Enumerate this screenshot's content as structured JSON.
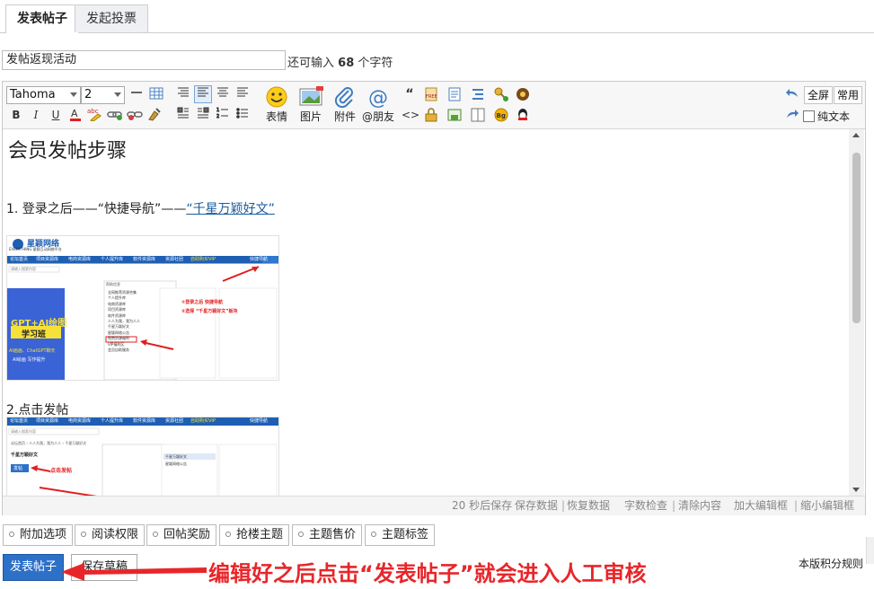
{
  "tabs": [
    {
      "label": "发表帖子",
      "active": true
    },
    {
      "label": "发起投票",
      "active": false
    }
  ],
  "subject": {
    "value": "发帖返现活动",
    "counter_prefix": "还可输入",
    "counter_number": "68",
    "counter_suffix": "个字符"
  },
  "toolbar": {
    "font_family": "Tahoma",
    "font_size": "2",
    "big_buttons": [
      "表情",
      "图片",
      "附件",
      "@朋友"
    ],
    "fullscreen": "全屏",
    "common": "常用",
    "plain_text": "纯文本"
  },
  "content": {
    "heading": "会员发帖步骤",
    "step1_text": "1. 登录之后——“快捷导航”——",
    "step1_link": "“千星万颖好文”",
    "step2_text": "2.点击发帖",
    "shot1": {
      "site_name": "星颖网络",
      "site_sub": "EVERYTHING 星颖互动网络平台",
      "nav": [
        "论坛首页",
        "项目资源库",
        "电商资源库",
        "个人提升库",
        "软件资源库",
        "资源社团",
        "自助购买VIP",
        "快捷导航"
      ],
      "search_placeholder": "请输入搜索内容",
      "panel_title": "帮助信息",
      "list": [
        "全网推荐资源合集",
        "个人提升库",
        "电商资源库",
        "项目资源库",
        "软件资源库",
        "人人为我，我为人人",
        "千星万颖好文",
        "星颖网络公告",
        "免费资源福利",
        "VIP福利区",
        "会员自助服务"
      ],
      "note1": "①登录之后 快捷导航",
      "note2": "②选择 “千星万颖好文”板块",
      "promo1": "GPT+AI绘图",
      "promo2": "学习班",
      "promo3": "AI画画、ChatGPT聊天",
      "promo4": "AI绘画 写作提升"
    },
    "shot2": {
      "nav": [
        "论坛首页",
        "项目资源库",
        "电商资源库",
        "个人提升库",
        "软件资源库",
        "资源社团",
        "自助购买VIP",
        "快捷导航"
      ],
      "search_placeholder": "请输入搜索内容",
      "breadcrumb": "论坛首页 › 人人为我，我为人人 › 千星万颖好文",
      "forum_title": "千星万颖好文",
      "post_button": "发帖",
      "note": "点击发帖",
      "side_item": "千星万颖好文",
      "side_item2": "星颖网络公告"
    }
  },
  "statusbar": {
    "autosave": "20 秒后保存",
    "save": "保存数据",
    "restore": "恢复数据",
    "check": "字数检查",
    "clear": "清除内容",
    "enlarge": "加大编辑框",
    "shrink": "缩小编辑框"
  },
  "options": [
    "附加选项",
    "阅读权限",
    "回帖奖励",
    "抢楼主题",
    "主题售价",
    "主题标签"
  ],
  "footer": {
    "submit": "发表帖子",
    "draft": "保存草稿",
    "rules": "本版积分规则",
    "annotation": "编辑好之后点击“发表帖子”就会进入人工审核"
  },
  "colors": {
    "accent": "#2d70c8",
    "annotation": "#e8262a",
    "link": "#1a5c9e",
    "site_nav": "#1e5fb3"
  }
}
